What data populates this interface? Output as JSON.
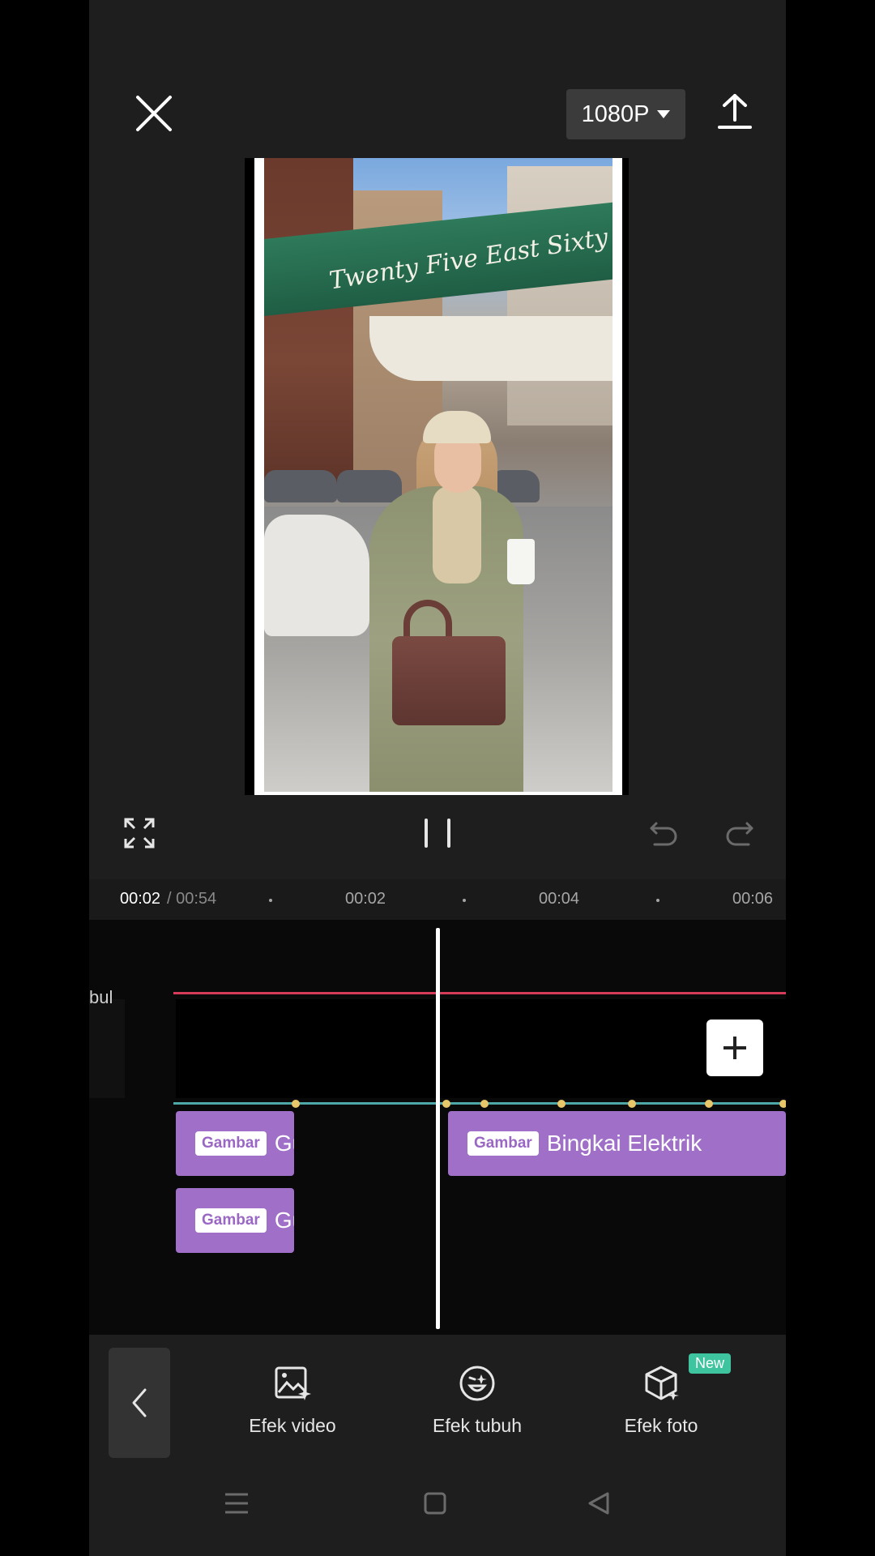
{
  "top_bar": {
    "resolution_label": "1080P"
  },
  "preview": {
    "awning_text": "Twenty Five East Sixty Seven"
  },
  "timeline": {
    "current_time": "00:02",
    "total_time": "/ 00:54",
    "ticks": [
      "00:02",
      "00:04",
      "00:06"
    ],
    "track_label": "bul",
    "clips": [
      {
        "tag": "Gambar",
        "title": "Gu"
      },
      {
        "tag": "Gambar",
        "title": "Bingkai Elektrik"
      },
      {
        "tag": "Gambar",
        "title": "Gu"
      }
    ]
  },
  "toolbar": {
    "items": [
      {
        "label": "Efek video",
        "icon": "image-sparkle-icon"
      },
      {
        "label": "Efek tubuh",
        "icon": "face-sticker-icon"
      },
      {
        "label": "Efek foto",
        "icon": "cube-sparkle-icon"
      }
    ],
    "new_badge": "New"
  },
  "colors": {
    "clip_purple": "#a06fc8",
    "audio_red": "#d63c5a",
    "keyframe_teal": "#4fa8a8",
    "keyframe_dot": "#e8c66a",
    "badge_green": "#3fc4a0"
  }
}
